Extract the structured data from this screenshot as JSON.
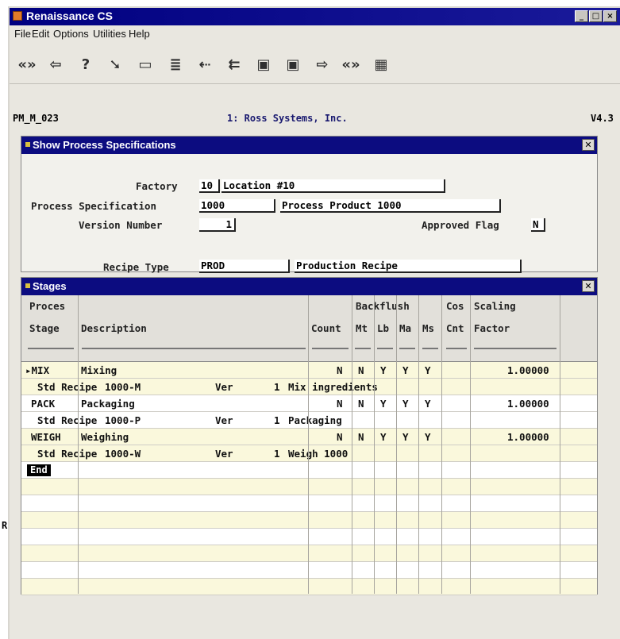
{
  "window": {
    "title": "Renaissance CS",
    "controls": [
      "_",
      "□",
      "×"
    ]
  },
  "menu": [
    "File",
    "Edit",
    "Options",
    "Utilities",
    "Help"
  ],
  "toolbar": {
    "icons": [
      "first-record-icon",
      "previous-record-icon",
      "help-icon",
      "select-arrow-icon",
      "folder-icon",
      "print-icon",
      "insert-icon",
      "delete-icon",
      "save-icon",
      "refresh-icon",
      "next-record-icon",
      "last-record-icon",
      "calculator-icon"
    ],
    "glyphs": [
      "«»",
      "⇦",
      "?",
      "➘",
      "▭",
      "≣",
      "⇠",
      "⇇",
      "▣",
      "▣",
      "⇨",
      "«»",
      "▦"
    ]
  },
  "status": {
    "screen_id": "PM_M_023",
    "company": "1: Ross Systems, Inc.",
    "version": "V4.3"
  },
  "spec_dialog": {
    "title": "Show Process Specifications",
    "factory_label": "Factory",
    "factory_code": "10",
    "factory_name": "Location #10",
    "spec_label": "Process Specification",
    "spec_code": "1000",
    "spec_name": "Process Product 1000",
    "version_label": "Version Number",
    "version_value": "1",
    "approved_label": "Approved Flag",
    "approved_value": "N",
    "recipe_label": "Recipe Type",
    "recipe_code": "PROD",
    "recipe_name": "Production Recipe"
  },
  "stages_dialog": {
    "title": "Stages",
    "headers": {
      "stage_top": "Proces",
      "stage": "Stage",
      "description": "Description",
      "count": "Count",
      "backflush": "Backflush",
      "mt": "Mt",
      "lb": "Lb",
      "ma": "Ma",
      "ms": "Ms",
      "cos": "Cos",
      "cnt": "Cnt",
      "scaling": "Scaling",
      "factor": "Factor"
    },
    "rows": [
      {
        "stage": "▸MIX",
        "description": "Mixing",
        "count": "N",
        "mt": "N",
        "lb": "Y",
        "ma": "Y",
        "ms": "Y",
        "factor": "1.00000",
        "recipe": {
          "label": "Std Recipe",
          "code": "1000-M",
          "ver_label": "Ver",
          "ver": "1",
          "desc": "Mix ingredients"
        }
      },
      {
        "stage": "PACK",
        "description": "Packaging",
        "count": "N",
        "mt": "N",
        "lb": "Y",
        "ma": "Y",
        "ms": "Y",
        "factor": "1.00000",
        "recipe": {
          "label": "Std Recipe",
          "code": "1000-P",
          "ver_label": "Ver",
          "ver": "1",
          "desc": "Packaging"
        }
      },
      {
        "stage": "WEIGH",
        "description": "Weighing",
        "count": "N",
        "mt": "N",
        "lb": "Y",
        "ma": "Y",
        "ms": "Y",
        "factor": "1.00000",
        "recipe": {
          "label": "Std Recipe",
          "code": "1000-W",
          "ver_label": "Ver",
          "ver": "1",
          "desc": "Weigh 1000"
        }
      }
    ],
    "end_label": "End",
    "side_marker": "R"
  }
}
